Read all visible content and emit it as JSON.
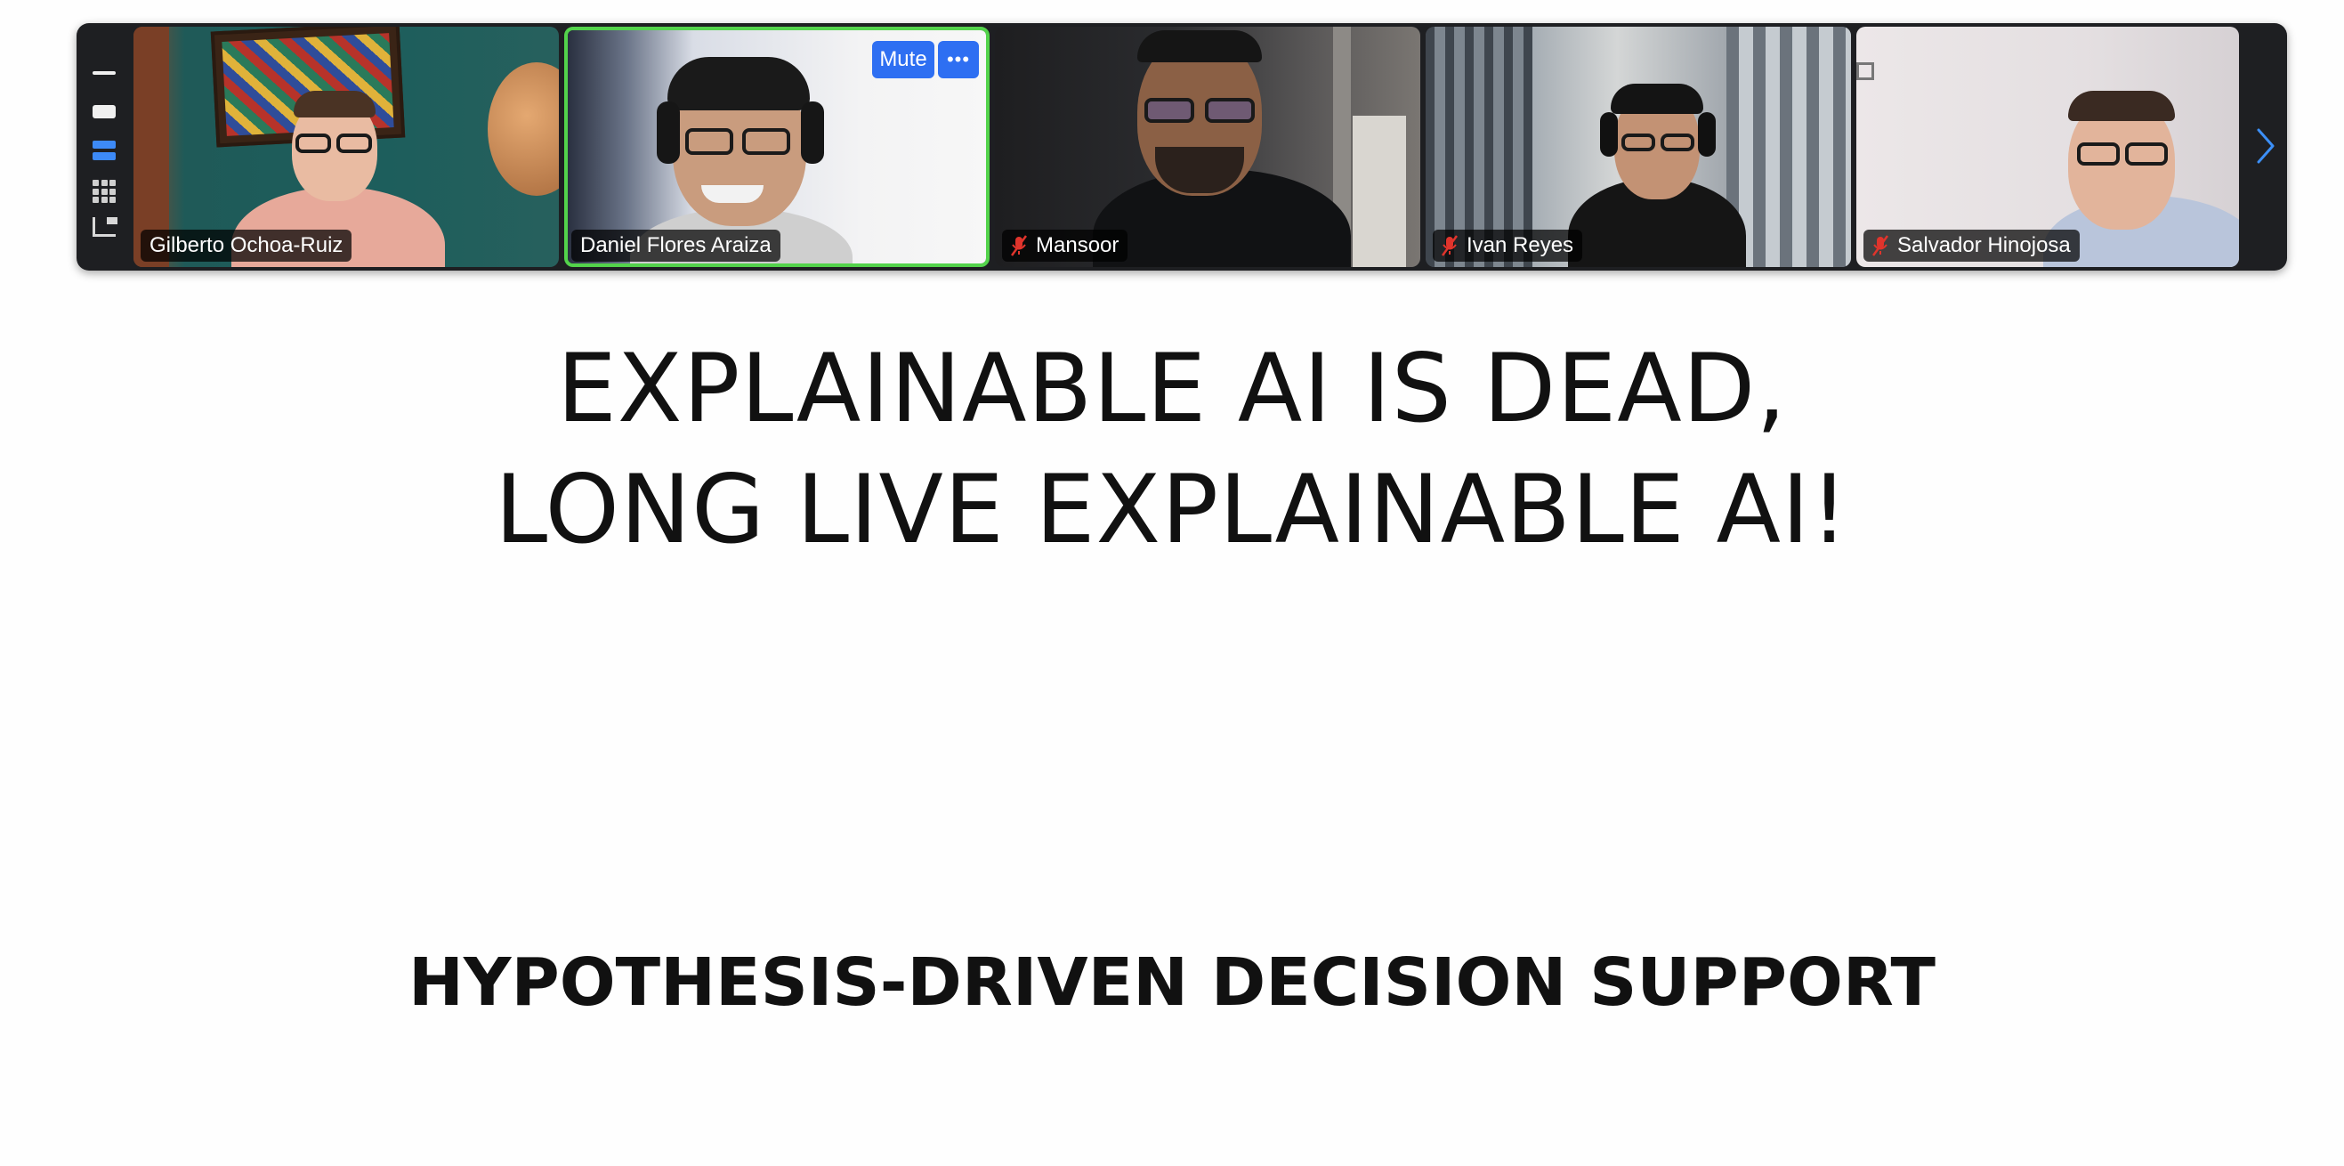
{
  "meeting": {
    "participants": [
      {
        "name": "Gilberto Ochoa-Ruiz",
        "muted": false,
        "active_speaker": false
      },
      {
        "name": "Daniel Flores Araiza",
        "muted": false,
        "active_speaker": true
      },
      {
        "name": "Mansoor",
        "muted": true,
        "active_speaker": false
      },
      {
        "name": "Ivan Reyes",
        "muted": true,
        "active_speaker": false
      },
      {
        "name": "Salvador Hinojosa",
        "muted": true,
        "active_speaker": false
      }
    ],
    "hover_controls": {
      "mute_label": "Mute",
      "more_label": "•••"
    },
    "next_page_icon": "chevron-right-icon",
    "colors": {
      "active_border": "#53d34b",
      "button_blue": "#2e6ff2",
      "muted_icon": "#e0342c"
    }
  },
  "slide": {
    "title_line1": "EXPLAINABLE AI IS DEAD,",
    "title_line2": "LONG LIVE EXPLAINABLE AI!",
    "subtitle": "HYPOTHESIS-DRIVEN DECISION SUPPORT"
  }
}
